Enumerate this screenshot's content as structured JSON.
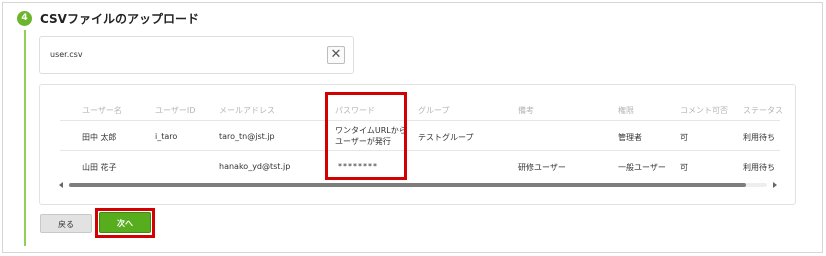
{
  "step": {
    "number": "4",
    "title": "CSVファイルのアップロード"
  },
  "file": {
    "name": "user.csv",
    "clear_icon": "close-icon",
    "clear_glyph": "✕"
  },
  "table": {
    "headers": [
      "ユーザー名",
      "ユーザーID",
      "メールアドレス",
      "パスワード",
      "グループ",
      "備考",
      "権限",
      "コメント可否",
      "ステータス"
    ],
    "rows": [
      {
        "user_name": "田中 太郎",
        "user_id": "i_taro",
        "email": "taro_tn@jst.jp",
        "password_line1": "ワンタイムURLから",
        "password_line2": "ユーザーが発行",
        "group": "テストグループ",
        "note": "",
        "role": "管理者",
        "comment": "可",
        "status": "利用待ち"
      },
      {
        "user_name": "山田 花子",
        "user_id": "",
        "email": "hanako_yd@tst.jp",
        "password": "********",
        "group": "",
        "note": "研修ユーザー",
        "role": "一般ユーザー",
        "comment": "可",
        "status": "利用待ち"
      }
    ],
    "scroll_position": 0.97
  },
  "buttons": {
    "back": "戻る",
    "next": "次へ"
  },
  "colors": {
    "accent_green": "#57ad1e",
    "step_green": "#6cb52d",
    "highlight_red": "#d20000"
  }
}
